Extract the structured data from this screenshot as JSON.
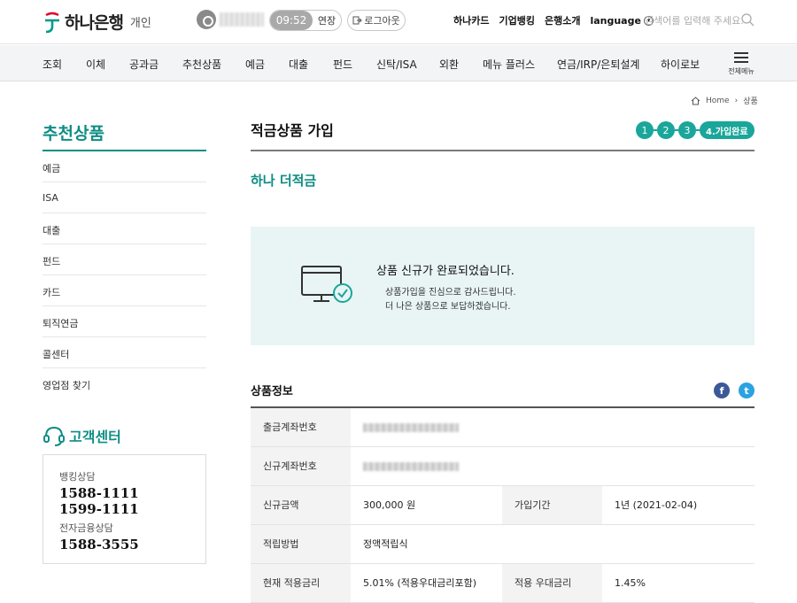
{
  "header": {
    "brand": "하나은행",
    "section": "개인",
    "timer": "09:52",
    "extend_label": "연장",
    "logout_label": "로그아웃",
    "links": [
      "하나카드",
      "기업뱅킹",
      "은행소개"
    ],
    "language_label": "language",
    "search_placeholder": "검색어를 입력해 주세요."
  },
  "gnb": {
    "items": [
      "조회",
      "이체",
      "공과금",
      "추천상품",
      "예금",
      "대출",
      "펀드",
      "신탁/ISA",
      "외환",
      "메뉴 플러스",
      "연금/IRP/은퇴설계",
      "하이로보"
    ],
    "all_menu_label": "전체메뉴"
  },
  "breadcrumb": {
    "home": "Home",
    "current": "상품"
  },
  "sidebar": {
    "title": "추천상품",
    "items": [
      "예금",
      "ISA",
      "대출",
      "펀드",
      "카드",
      "퇴직연금",
      "콜센터",
      "영업점 찾기"
    ],
    "customer_center": {
      "title": "고객센터",
      "banking_label": "뱅킹상담",
      "banking_numbers": [
        "1588-1111",
        "1599-1111"
      ],
      "efinance_label": "전자금융상담",
      "efinance_number": "1588-3555"
    }
  },
  "main": {
    "title": "적금상품 가입",
    "steps": [
      "1",
      "2",
      "3",
      "4.가입완료"
    ],
    "product_name": "하나 더적금",
    "complete_message": "상품 신규가 완료되었습니다.",
    "complete_sub1": "상품가입을 진심으로 감사드립니다.",
    "complete_sub2": "더 나은 상품으로 보답하겠습니다.",
    "info_title": "상품정보",
    "info": {
      "withdraw_account_label": "출금계좌번호",
      "new_account_label": "신규계좌번호",
      "amount_label": "신규금액",
      "amount_value": "300,000 원",
      "period_label": "가입기간",
      "period_value": "1년 (2021-02-04)",
      "method_label": "적립방법",
      "method_value": "정액적립식",
      "rate_label": "현재 적용금리",
      "rate_value": "5.01% (적용우대금리포함)",
      "pref_rate_label": "적용 우대금리",
      "pref_rate_value": "1.45%"
    }
  }
}
